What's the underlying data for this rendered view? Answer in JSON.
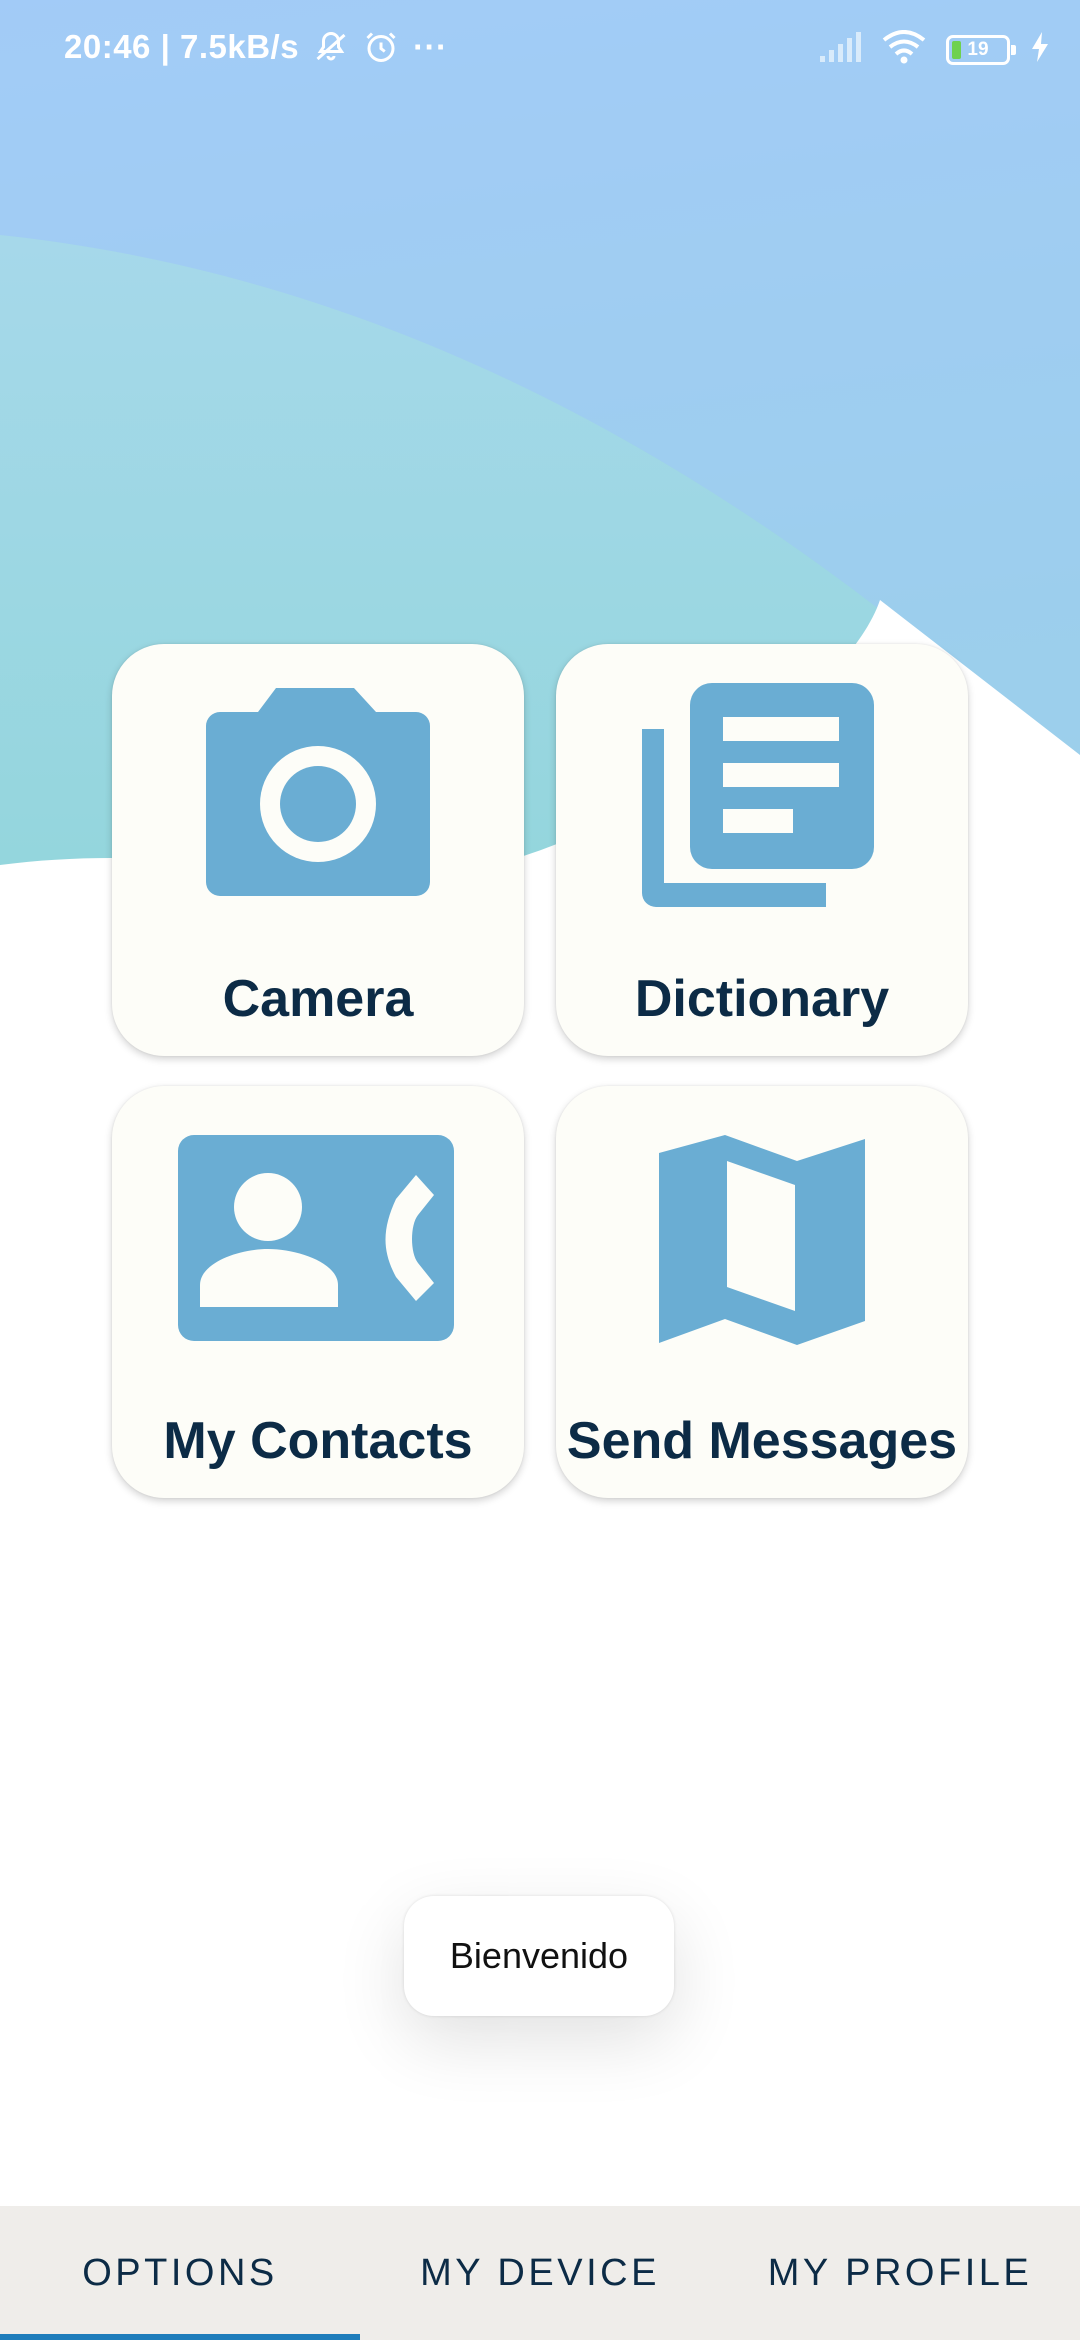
{
  "status_bar": {
    "time_speed": "20:46 | 7.5kB/s",
    "more": "···",
    "battery_level": "19",
    "icons": [
      "bell-off-icon",
      "alarm-icon",
      "signal-icon",
      "wifi-icon",
      "battery-icon",
      "charging-icon"
    ]
  },
  "tiles": [
    {
      "label": "Camera",
      "icon": "camera-icon"
    },
    {
      "label": "Dictionary",
      "icon": "dictionary-icon"
    },
    {
      "label": "My Contacts",
      "icon": "contacts-icon"
    },
    {
      "label": "Send Messages",
      "icon": "map-icon"
    }
  ],
  "toast": {
    "text": "Bienvenido"
  },
  "tabs": [
    {
      "label": "OPTIONS",
      "selected": true
    },
    {
      "label": "MY DEVICE",
      "selected": false
    },
    {
      "label": "MY PROFILE",
      "selected": false
    }
  ],
  "colors": {
    "icon_blue": "#6aadd3",
    "label_navy": "#0c2b46",
    "tile_bg": "#fdfdf8",
    "tab_indicator": "#1f7dbb",
    "tabbar_bg": "#efedea",
    "sky_top": "#a2cbf7",
    "sky_teal": "#93d4df"
  }
}
